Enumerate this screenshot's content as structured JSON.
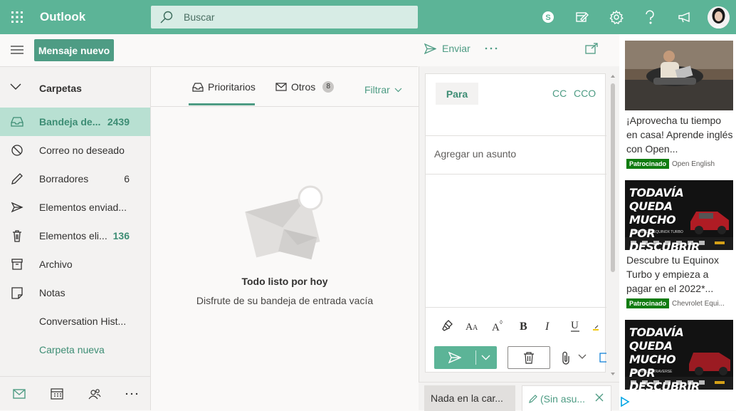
{
  "app": {
    "name": "Outlook"
  },
  "search": {
    "placeholder": "Buscar"
  },
  "header_icons": [
    "skype-icon",
    "my-day-icon",
    "settings-icon",
    "help-icon",
    "feedback-icon"
  ],
  "command_bar": {
    "new_message": "Mensaje nuevo",
    "send": "Enviar"
  },
  "folders": {
    "header": "Carpetas",
    "items": [
      {
        "label": "Bandeja de...",
        "count": "2439",
        "icon": "inbox-icon",
        "selected": true
      },
      {
        "label": "Correo no deseado",
        "count": "",
        "icon": "junk-icon"
      },
      {
        "label": "Borradores",
        "count": "6",
        "icon": "drafts-icon"
      },
      {
        "label": "Elementos enviad...",
        "count": "",
        "icon": "sent-icon"
      },
      {
        "label": "Elementos eli...",
        "count": "136",
        "icon": "deleted-icon"
      },
      {
        "label": "Archivo",
        "count": "",
        "icon": "archive-icon"
      },
      {
        "label": "Notas",
        "count": "",
        "icon": "notes-icon"
      },
      {
        "label": "Conversation Hist...",
        "count": ""
      }
    ],
    "new_folder": "Carpeta nueva"
  },
  "message_list": {
    "tab_focused": "Prioritarios",
    "tab_other": "Otros",
    "other_count": "8",
    "filter": "Filtrar",
    "empty_title": "Todo listo por hoy",
    "empty_subtitle": "Disfrute de su bandeja de entrada vacía"
  },
  "compose": {
    "to_label": "Para",
    "cc_label": "CC",
    "bcc_label": "CCO",
    "subject_placeholder": "Agregar un asunto"
  },
  "bottom_tabs": {
    "tab1": "Nada en la car...",
    "tab2": "(Sin asu..."
  },
  "ads": [
    {
      "text": "¡Aprovecha tu tiempo en casa! Aprende inglés con Open...",
      "sponsored": "Patrocinado",
      "advertiser": "Open English"
    },
    {
      "text": "Descubre tu Equinox Turbo y empieza a pagar en el 2022*...",
      "sponsored": "Patrocinado",
      "advertiser": "Chevrolet Equi...",
      "image_headline": "TODAVÍA QUEDA MUCHO POR DESCUBRIR",
      "image_caption": "CHEVROLET EQUINOX TURBO"
    },
    {
      "image_headline": "TODAVÍA QUEDA MUCHO POR DESCUBRIR",
      "image_caption": "CHEVROLET TRAVERSE"
    }
  ],
  "colors": {
    "brand": "#5cb497",
    "brand_dark": "#4e9c84",
    "selected_folder": "#b8e0d2",
    "sponsored_tag": "#107c10"
  }
}
